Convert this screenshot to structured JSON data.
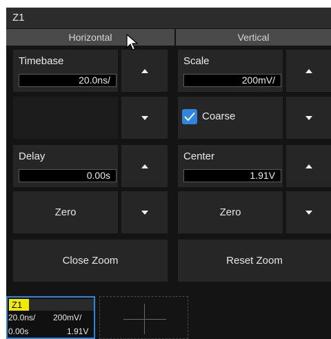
{
  "window": {
    "title": "Z1"
  },
  "columns": {
    "horizontal": "Horizontal",
    "vertical": "Vertical"
  },
  "horizontal": {
    "timebase": {
      "label": "Timebase",
      "value": "20.0ns/"
    },
    "delay": {
      "label": "Delay",
      "value": "0.00s"
    },
    "zero_label": "Zero",
    "close_zoom_label": "Close Zoom"
  },
  "vertical": {
    "scale": {
      "label": "Scale",
      "value": "200mV/"
    },
    "coarse": {
      "label": "Coarse",
      "checked": true
    },
    "center": {
      "label": "Center",
      "value": "1.91V"
    },
    "zero_label": "Zero",
    "reset_zoom_label": "Reset Zoom"
  },
  "thumbnail": {
    "tag": "Z1",
    "timebase": "20.0ns/",
    "scale": "200mV/",
    "delay": "0.00s",
    "center": "1.91V"
  },
  "colors": {
    "accent": "#2e86de",
    "tag": "#f2ea00",
    "panel": "#141414",
    "button": "#262626"
  }
}
